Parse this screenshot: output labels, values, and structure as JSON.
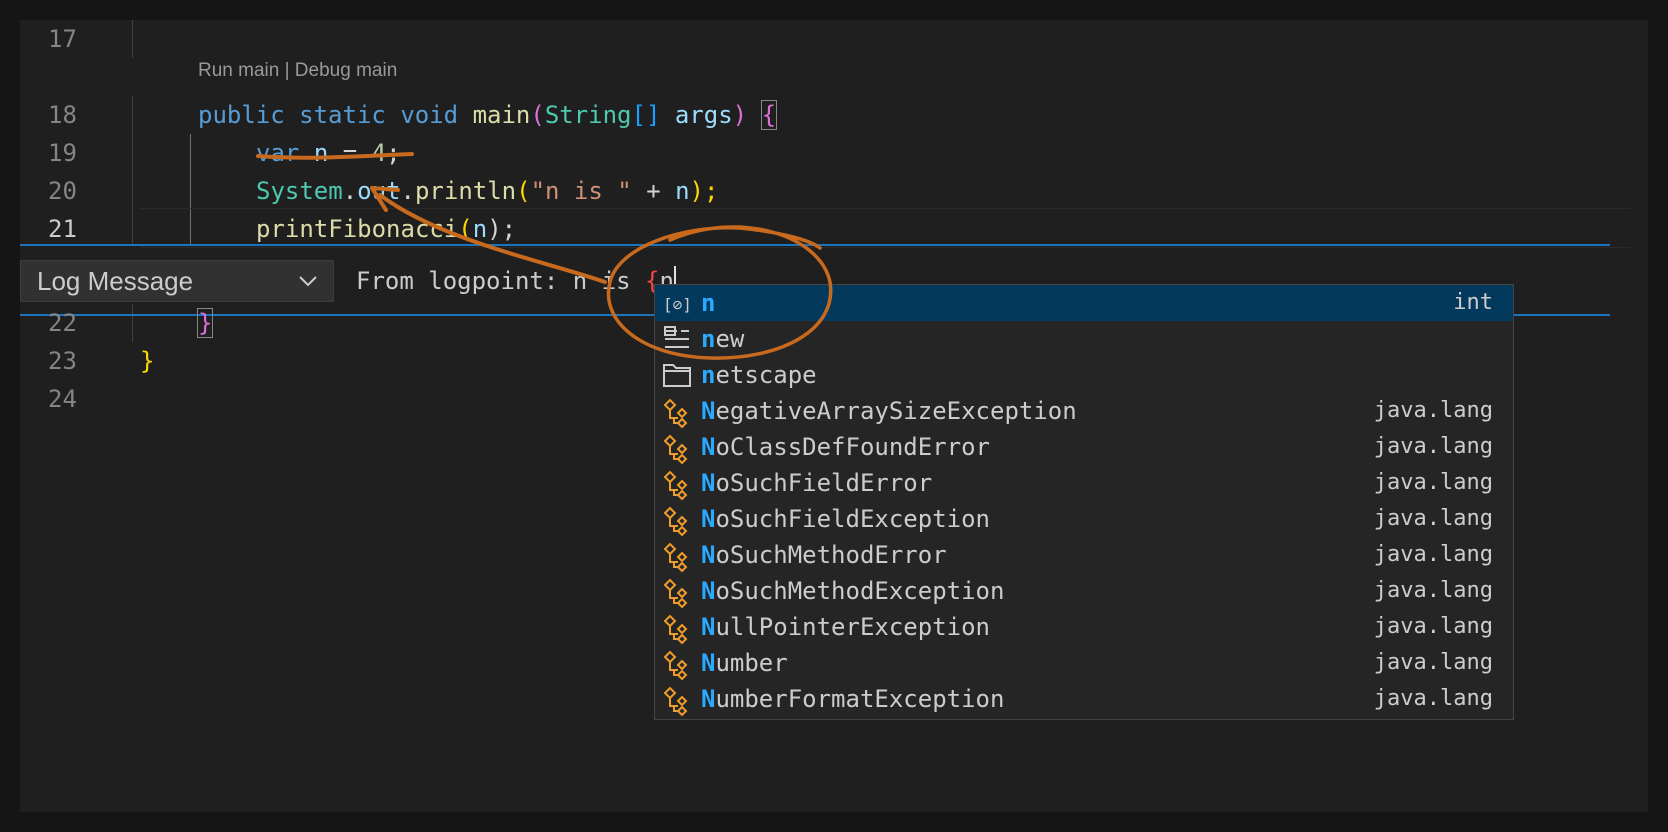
{
  "codelens": "Run main | Debug main",
  "lines": [
    {
      "num": "17"
    },
    {
      "num": "18"
    },
    {
      "num": "19"
    },
    {
      "num": "20"
    },
    {
      "num": "21"
    },
    {
      "num": "22"
    },
    {
      "num": "23"
    },
    {
      "num": "24"
    }
  ],
  "code": {
    "l18": [
      "public",
      "static",
      "void",
      "main",
      "(",
      "String",
      "[]",
      "args",
      ")",
      "{"
    ],
    "l19": [
      "var",
      "n",
      "=",
      "4",
      ";"
    ],
    "l20": [
      "System",
      ".",
      "out",
      ".",
      "println",
      "(",
      "\"n is \"",
      "+",
      "n",
      ");"
    ],
    "l21": [
      "printFibonacci",
      "(",
      "n",
      ");"
    ],
    "l22": "}",
    "l23": "}"
  },
  "logpoint": {
    "type": "Log Message",
    "prefix": "From logpoint: n is ",
    "brace": "{",
    "typed": "n"
  },
  "suggestions": [
    {
      "icon": "variable-icon",
      "match": "n",
      "rest": "",
      "detail": "int",
      "selected": true
    },
    {
      "icon": "snippet-icon",
      "match": "n",
      "rest": "ew",
      "detail": ""
    },
    {
      "icon": "folder-icon",
      "match": "n",
      "rest": "etscape",
      "detail": ""
    },
    {
      "icon": "class-icon",
      "match": "N",
      "rest": "egativeArraySizeException",
      "detail": "java.lang"
    },
    {
      "icon": "class-icon",
      "match": "N",
      "rest": "oClassDefFoundError",
      "detail": "java.lang"
    },
    {
      "icon": "class-icon",
      "match": "N",
      "rest": "oSuchFieldError",
      "detail": "java.lang"
    },
    {
      "icon": "class-icon",
      "match": "N",
      "rest": "oSuchFieldException",
      "detail": "java.lang"
    },
    {
      "icon": "class-icon",
      "match": "N",
      "rest": "oSuchMethodError",
      "detail": "java.lang"
    },
    {
      "icon": "class-icon",
      "match": "N",
      "rest": "oSuchMethodException",
      "detail": "java.lang"
    },
    {
      "icon": "class-icon",
      "match": "N",
      "rest": "ullPointerException",
      "detail": "java.lang"
    },
    {
      "icon": "class-icon",
      "match": "N",
      "rest": "umber",
      "detail": "java.lang"
    },
    {
      "icon": "class-icon",
      "match": "N",
      "rest": "umberFormatException",
      "detail": "java.lang"
    }
  ],
  "colors": {
    "annotation": "#c86a1e",
    "zone_border": "#1c75bc",
    "selected_row": "#04395e",
    "match_highlight": "#2aaaff"
  }
}
